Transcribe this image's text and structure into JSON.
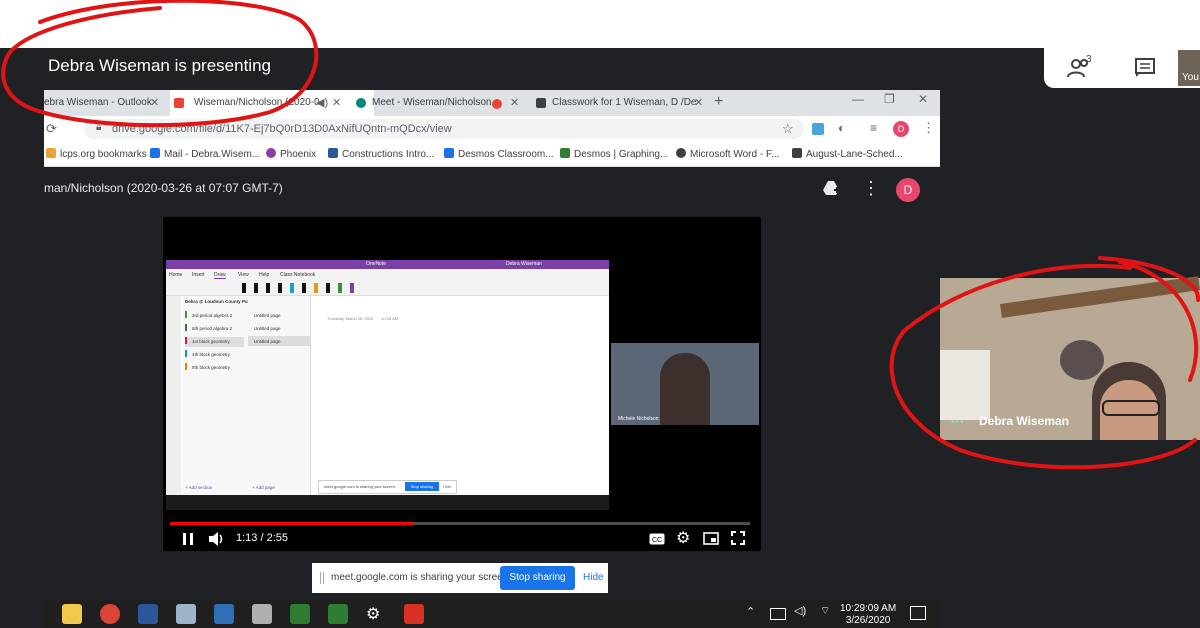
{
  "meet": {
    "presenting_banner": "Debra Wiseman is presenting",
    "people_count": "3",
    "self_tile_label": "You",
    "participant_name": "Debra Wiseman"
  },
  "browser": {
    "tabs": [
      {
        "label": "ebra Wiseman - Outlook"
      },
      {
        "label": "Wiseman/Nicholson (2020-0"
      },
      {
        "label": "Meet - Wiseman/Nicholson"
      },
      {
        "label": "Classwork for 1 Wiseman, D /De"
      }
    ],
    "url": "drive.google.com/file/d/11K7-Ej7bQ0rD13D0AxNifUQntn-mQDcx/view",
    "profile_initial": "D",
    "bookmarks": [
      {
        "label": "lcps.org bookmarks",
        "color": "#e8a33d"
      },
      {
        "label": "Mail - Debra.Wisem...",
        "color": "#1a73e8"
      },
      {
        "label": "Phoenix",
        "color": "#8b3fa8"
      },
      {
        "label": "Constructions Intro...",
        "color": "#2b579a"
      },
      {
        "label": "Desmos Classroom...",
        "color": "#1a73e8"
      },
      {
        "label": "Desmos | Graphing...",
        "color": "#2e7d32"
      },
      {
        "label": "Microsoft Word - F...",
        "color": "#3c4043"
      },
      {
        "label": "August-Lane-Sched...",
        "color": "#3c4043"
      }
    ]
  },
  "drive_viewer": {
    "file_title": "man/Nicholson (2020-03-26 at 07:07 GMT-7)",
    "avatar_initial": "D"
  },
  "video": {
    "time_display": "1:13 / 2:55",
    "progress_fraction": 0.42,
    "onenote": {
      "app_title": "OneNote",
      "user": "Debra Wiseman",
      "ribbon_tabs": [
        "Home",
        "Insert",
        "Draw",
        "View",
        "Help",
        "Class Notebook"
      ],
      "notebook": "Debra @ Loudoun County Public Schools",
      "sections": [
        {
          "label": "3rd period algebra 2",
          "color": "#3a8f3a"
        },
        {
          "label": "6th period algebra 2",
          "color": "#2e7d32"
        },
        {
          "label": "1st block geometry",
          "color": "#c2185b"
        },
        {
          "label": "4th block geometry",
          "color": "#1e88e5"
        },
        {
          "label": "8th block geometry",
          "color": "#f57c00"
        }
      ],
      "pages": [
        "Untitled page",
        "Untitled page",
        "Untitled page"
      ],
      "page_date": "Thursday, March 26, 2020",
      "page_time": "10:08 AM",
      "add_section": "+ Add section",
      "add_page": "+ Add page",
      "share_text": "meet.google.com is sharing your screen.",
      "stop_sharing": "Stop sharing",
      "hide": "Hide",
      "nested_participant": "Michele Nicholson"
    }
  },
  "sharing_bar": {
    "text": "meet.google.com is sharing your screen.",
    "stop_label": "Stop sharing",
    "hide_label": "Hide"
  },
  "taskbar": {
    "time": "10:29:09 AM",
    "date": "3/26/2020",
    "apps": [
      {
        "name": "file-explorer",
        "color": "#f2c94c"
      },
      {
        "name": "chrome",
        "color": "#db4437"
      },
      {
        "name": "word",
        "color": "#2b579a"
      },
      {
        "name": "paint",
        "color": "#9fb4c8"
      },
      {
        "name": "visio",
        "color": "#2f6fb7"
      },
      {
        "name": "drawing",
        "color": "#b0b0b0"
      },
      {
        "name": "desmos-1",
        "color": "#2e7d32"
      },
      {
        "name": "desmos-2",
        "color": "#2e7d32"
      },
      {
        "name": "settings",
        "color": "#ffffff"
      },
      {
        "name": "pdf",
        "color": "#d93025"
      }
    ]
  },
  "annotation_color": "#e01414"
}
